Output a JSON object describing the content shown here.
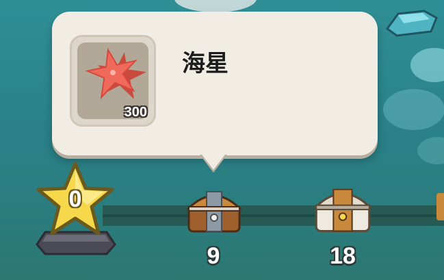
{
  "tooltip": {
    "item_name": "海星",
    "item_count": "300",
    "item_icon": "starfish-icon"
  },
  "progress_track": {
    "star_milestone": {
      "icon": "star-icon",
      "value": "0"
    },
    "chests": [
      {
        "icon": "wooden-chest-icon",
        "label": "9"
      },
      {
        "icon": "silver-chest-icon",
        "label": "18"
      }
    ]
  },
  "colors": {
    "water": "#2a8189",
    "tooltip_bg": "#f1ece4",
    "star": "#f7d84a",
    "track": "#275a52"
  }
}
